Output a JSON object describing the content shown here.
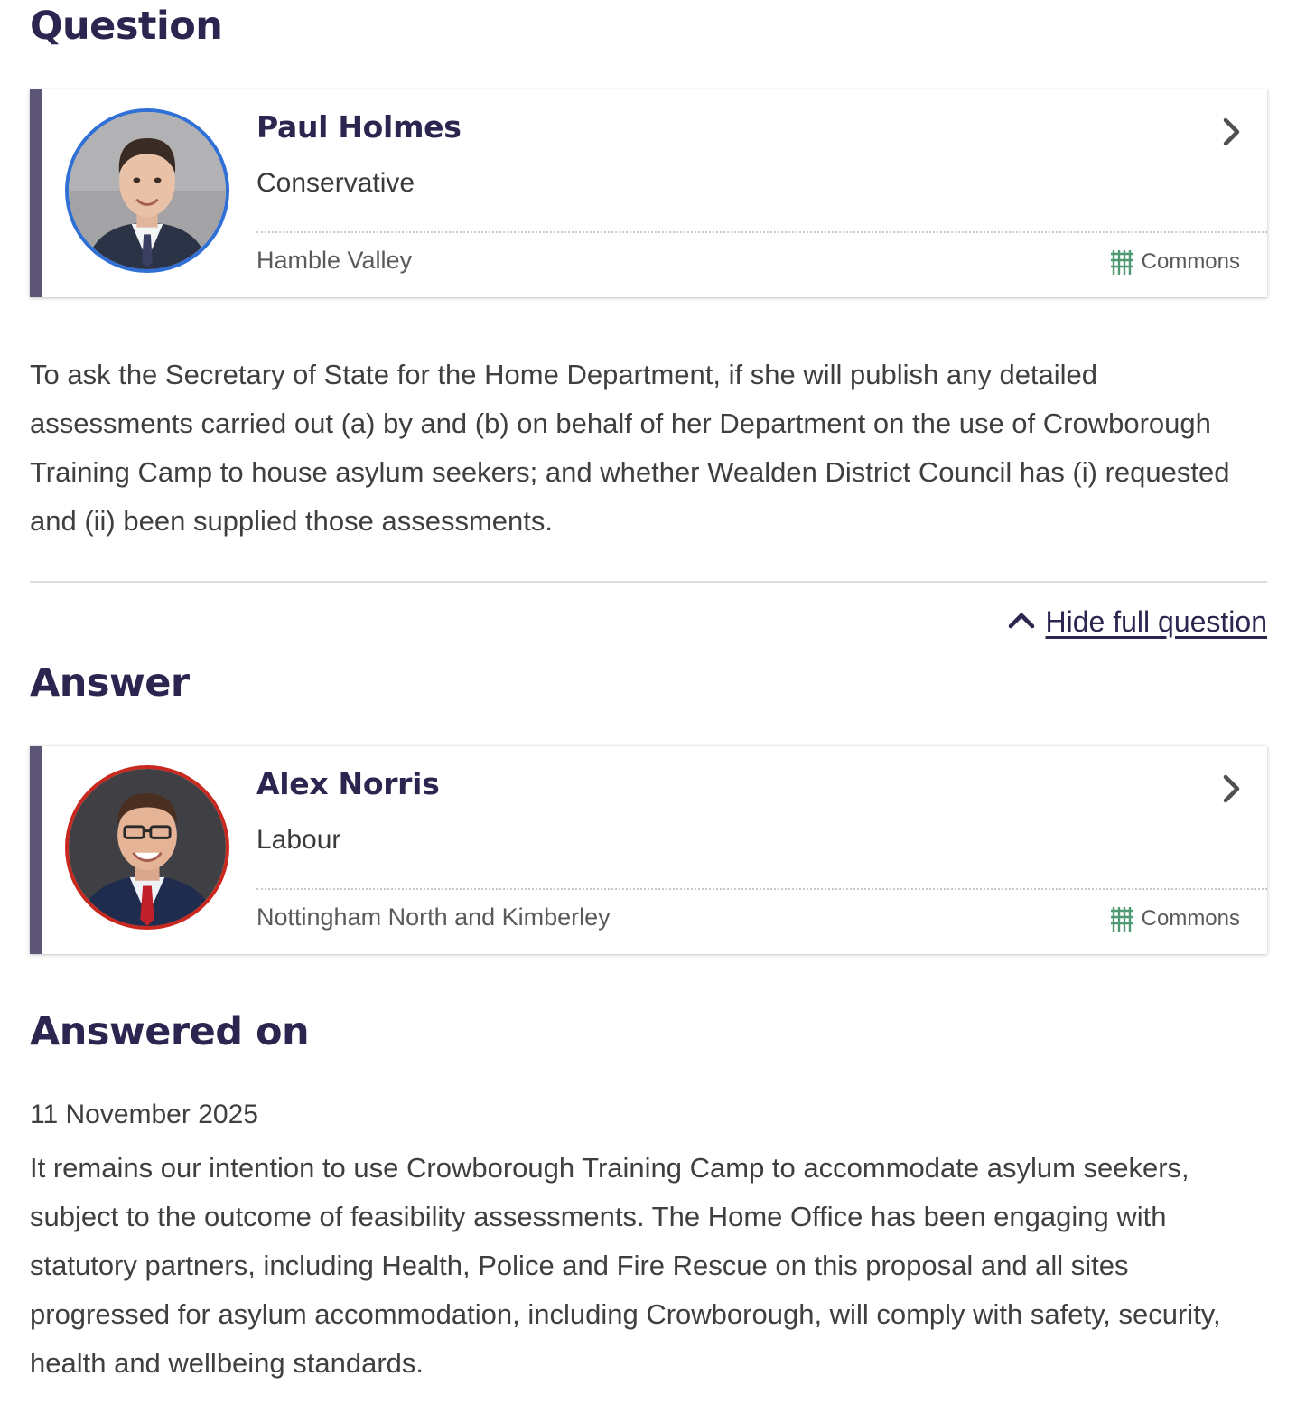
{
  "question": {
    "heading": "Question",
    "member": {
      "name": "Paul Holmes",
      "party": "Conservative",
      "constituency": "Hamble Valley",
      "house": "Commons",
      "party_color": "#2f6fd6"
    },
    "text": "To ask the Secretary of State for the Home Department, if she will publish any detailed assessments carried out (a) by and (b) on behalf of her Department on the use of Crowborough Training Camp to house asylum seekers; and whether Wealden District Council has (i) requested and (ii) been supplied those assessments.",
    "toggle_label": "Hide full question"
  },
  "answer": {
    "heading": "Answer",
    "member": {
      "name": "Alex Norris",
      "party": "Labour",
      "constituency": "Nottingham North and Kimberley",
      "house": "Commons",
      "party_color": "#c8281e"
    }
  },
  "answered": {
    "heading": "Answered on",
    "date": "11 November 2025",
    "text": "It remains our intention to use Crowborough Training Camp to accommodate asylum seekers, subject to the outcome of feasibility assessments. The Home Office has been engaging with statutory partners, including Health, Police and Fire Rescue on this proposal and all sites progressed for asylum accommodation, including Crowborough, will comply with safety, security, health and wellbeing standards."
  },
  "icons": {
    "chevron": "chevron-right-icon",
    "house": "portcullis-icon",
    "toggle": "chevron-up-icon"
  },
  "colors": {
    "heading": "#2a2650",
    "card_border": "#5d5575",
    "house_icon": "#4f9a72"
  }
}
